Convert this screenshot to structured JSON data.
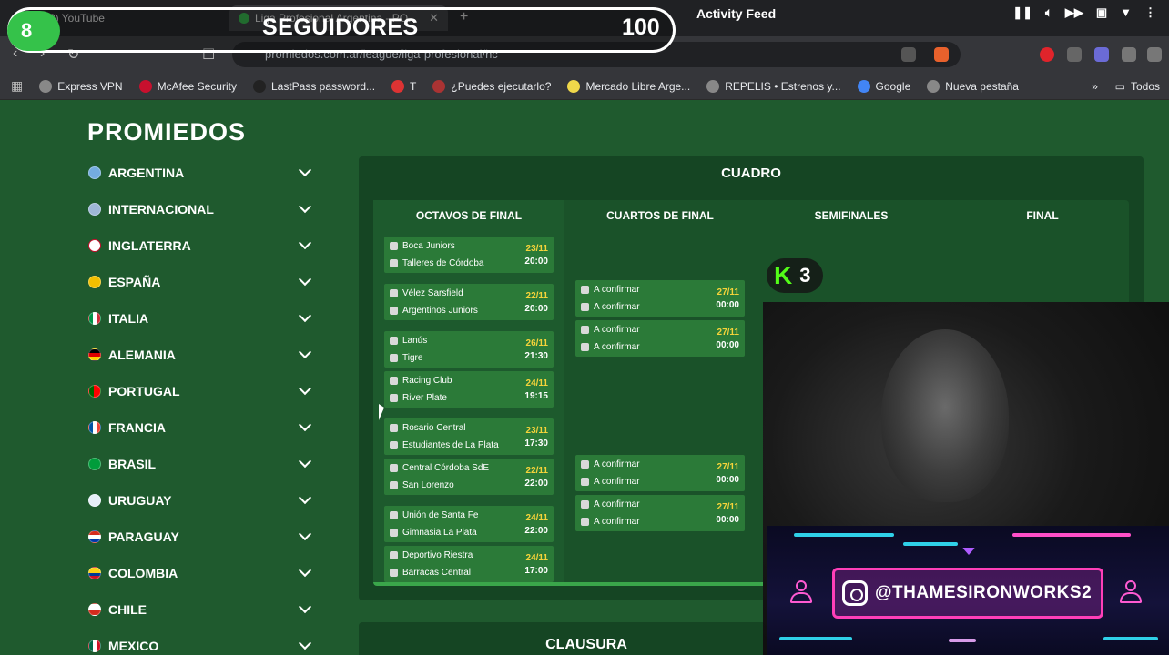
{
  "browser": {
    "tabs": [
      {
        "label": "(8) YouTube"
      },
      {
        "label": "Liga Profesional Argentina - PO..."
      }
    ],
    "url": "promiedos.com.ar/league/liga-profesional/hc",
    "bookmarks": [
      "Express VPN",
      "McAfee Security",
      "LastPass password...",
      "T",
      "¿Puedes ejecutarlo?",
      "Mercado Libre Arge...",
      "REPELIS • Estrenos y...",
      "Google",
      "Nueva pestaña"
    ],
    "bookmarks_more": "Todos"
  },
  "overlay": {
    "seguidores_badge": "8",
    "seguidores_label": "SEGUIDORES",
    "seguidores_count": "100",
    "activity_feed": "Activity Feed",
    "kick_count": "3",
    "kick_logo": "K",
    "handle": "@THAMESIRONWORKS2"
  },
  "site": {
    "logo": "PROMIEDOS",
    "countries": [
      "ARGENTINA",
      "INTERNACIONAL",
      "INGLATERRA",
      "ESPAÑA",
      "ITALIA",
      "ALEMANIA",
      "PORTUGAL",
      "FRANCIA",
      "BRASIL",
      "URUGUAY",
      "PARAGUAY",
      "COLOMBIA",
      "CHILE",
      "MEXICO"
    ],
    "cuadro_title": "CUADRO",
    "rounds": [
      "OCTAVOS DE FINAL",
      "CUARTOS DE FINAL",
      "SEMIFINALES",
      "FINAL"
    ],
    "octavos": [
      {
        "home": "Boca Juniors",
        "away": "Talleres de Córdoba",
        "date": "23/11",
        "time": "20:00"
      },
      {
        "home": "Vélez Sarsfield",
        "away": "Argentinos Juniors",
        "date": "22/11",
        "time": "20:00"
      },
      {
        "home": "Lanús",
        "away": "Tigre",
        "date": "26/11",
        "time": "21:30"
      },
      {
        "home": "Racing Club",
        "away": "River Plate",
        "date": "24/11",
        "time": "19:15"
      },
      {
        "home": "Rosario Central",
        "away": "Estudiantes de La Plata",
        "date": "23/11",
        "time": "17:30"
      },
      {
        "home": "Central Córdoba SdE",
        "away": "San Lorenzo",
        "date": "22/11",
        "time": "22:00"
      },
      {
        "home": "Unión de Santa Fe",
        "away": "Gimnasia La Plata",
        "date": "24/11",
        "time": "22:00"
      },
      {
        "home": "Deportivo Riestra",
        "away": "Barracas Central",
        "date": "24/11",
        "time": "17:00"
      }
    ],
    "cuartos": [
      {
        "home": "A confirmar",
        "away": "A confirmar",
        "date": "27/11",
        "time": "00:00"
      },
      {
        "home": "A confirmar",
        "away": "A confirmar",
        "date": "27/11",
        "time": "00:00"
      },
      {
        "home": "A confirmar",
        "away": "A confirmar",
        "date": "27/11",
        "time": "00:00"
      },
      {
        "home": "A confirmar",
        "away": "A confirmar",
        "date": "27/11",
        "time": "00:00"
      }
    ],
    "clausura_title": "CLAUSURA"
  },
  "colors": {
    "page_green": "#1f5a2e",
    "match_green": "#2b7a38",
    "date_yellow": "#f5d33a",
    "kick_green": "#53fc18",
    "neon_pink": "#ff3fb8"
  }
}
